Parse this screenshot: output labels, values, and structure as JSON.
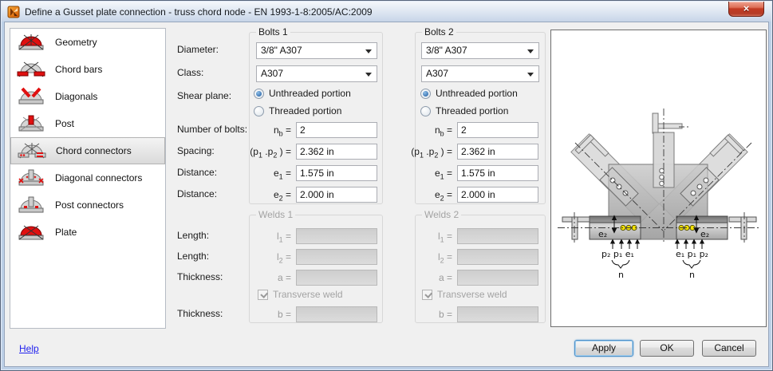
{
  "colors": {
    "accent_red": "#DD1111",
    "bolt_yellow": "#F4E300",
    "link_blue": "#2222EE",
    "close_button_red": "#C23A22",
    "titlebar_blue": "#C7D5E8",
    "selection_gray": "#DADADA"
  },
  "window": {
    "title": "Define a Gusset plate connection - truss chord node - EN 1993-1-8:2005/AC:2009",
    "close_glyph": "×"
  },
  "sidebar": {
    "selected_index": 4,
    "items": [
      {
        "label": "Geometry"
      },
      {
        "label": "Chord bars"
      },
      {
        "label": "Diagonals"
      },
      {
        "label": "Post"
      },
      {
        "label": "Chord connectors"
      },
      {
        "label": "Diagonal connectors"
      },
      {
        "label": "Post connectors"
      },
      {
        "label": "Plate"
      }
    ]
  },
  "form": {
    "labels": {
      "diameter": "Diameter:",
      "class": "Class:",
      "shear_plane": "Shear plane:",
      "number_of_bolts": "Number of bolts:",
      "spacing": "Spacing:",
      "distance_e1": "Distance:",
      "distance_e2": "Distance:",
      "length_l1": "Length:",
      "length_l2": "Length:",
      "thickness_a": "Thickness:",
      "thickness_b": "Thickness:"
    },
    "bolts1": {
      "title": "Bolts 1",
      "diameter": "3/8\" A307",
      "class": "A307",
      "shear_options": [
        "Unthreaded portion",
        "Threaded portion"
      ],
      "shear_selected": "Unthreaded portion",
      "nb_sym": "n<sub>b</sub> =",
      "nb_value": "2",
      "p_sym": "(p<sub>1</sub> .p<sub>2</sub> ) =",
      "p_value": "2.362 in",
      "e1_sym": "e<sub>1</sub> =",
      "e1_value": "1.575 in",
      "e2_sym": "e<sub>2</sub> =",
      "e2_value": "2.000 in"
    },
    "bolts2": {
      "title": "Bolts 2",
      "diameter": "3/8\" A307",
      "class": "A307",
      "shear_options": [
        "Unthreaded portion",
        "Threaded portion"
      ],
      "shear_selected": "Unthreaded portion",
      "nb_sym": "n<sub>b</sub> =",
      "nb_value": "2",
      "p_sym": "(p<sub>1</sub> .p<sub>2</sub> ) =",
      "p_value": "2.362 in",
      "e1_sym": "e<sub>1</sub> =",
      "e1_value": "1.575 in",
      "e2_sym": "e<sub>2</sub> =",
      "e2_value": "2.000 in"
    },
    "welds1": {
      "title": "Welds 1",
      "l1_sym": "l<sub>1</sub> =",
      "l1_value": "",
      "l2_sym": "l<sub>2</sub> =",
      "l2_value": "",
      "a_sym": "a =",
      "a_value": "",
      "transverse_label": "Transverse weld",
      "transverse_checked": true,
      "b_sym": "b =",
      "b_value": ""
    },
    "welds2": {
      "title": "Welds 2",
      "l1_sym": "l<sub>1</sub> =",
      "l1_value": "",
      "l2_sym": "l<sub>2</sub> =",
      "l2_value": "",
      "a_sym": "a =",
      "a_value": "",
      "transverse_label": "Transverse weld",
      "transverse_checked": true,
      "b_sym": "b =",
      "b_value": ""
    }
  },
  "diagram": {
    "labels": {
      "e2_left": "e₂",
      "e2_right": "e₂",
      "dims_left": "p₂ p₁ e₁",
      "dims_right": "e₁ p₁ p₂",
      "n_left": "n",
      "n_right": "n"
    }
  },
  "footer": {
    "help": "Help",
    "apply": "Apply",
    "ok": "OK",
    "cancel": "Cancel"
  }
}
